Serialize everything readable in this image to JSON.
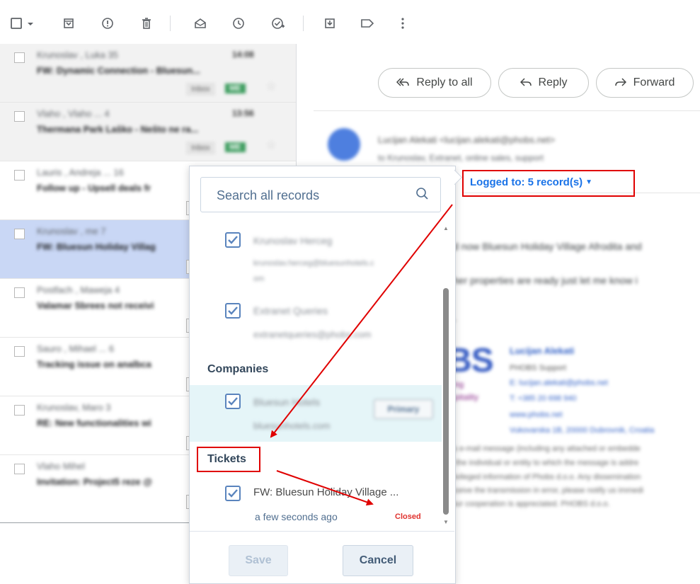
{
  "toolbar": {
    "icons": [
      "checkbox-icon",
      "chevron-down-icon",
      "archive-icon",
      "report-icon",
      "delete-icon",
      "mark-read-icon",
      "snooze-icon",
      "add-task-icon",
      "move-icon",
      "label-icon",
      "more-icon"
    ]
  },
  "email_list": {
    "rows": [
      {
        "sender": "Krunoslav , Luka 35",
        "subject": "FW: Dynamic Connection - Bluesun...",
        "time": "14:08",
        "label": "Inbox",
        "tag": "ME"
      },
      {
        "sender": "Vlaho , Vlaho ... 4",
        "subject": "Thermana Park Laško - Nešto ne ra...",
        "time": "13:56",
        "label": "Inbox",
        "tag": "ME"
      },
      {
        "sender": "Lauris , Andreja ... 16",
        "subject": "Follow up - Upsell deals fr"
      },
      {
        "sender": "Krunoslav , me 7",
        "subject": "FW: Bluesun Holiday Villag"
      },
      {
        "sender": "Postfach , Maweja 4",
        "subject": "Valamar Sbrees not receivi"
      },
      {
        "sender": "Sauro , Mihael ... 6",
        "subject": "Tracking issue on analbca"
      },
      {
        "sender": "Krunoslav, Maro 3",
        "subject": "RE: New functionalities wi"
      },
      {
        "sender": "Vlaho Mihel",
        "subject": "Invitation: Project5 reze @"
      }
    ]
  },
  "email": {
    "actions": {
      "reply_all": "Reply to all",
      "reply": "Reply",
      "forward": "Forward"
    },
    "from": "Lucijan Alekati <lucijan.alekati@phobs.net>",
    "to": "to Krunoslav, Extranet, online sales, support",
    "logged_to": "Logged to: 5 record(s)",
    "body": [
      "d now Bluesun Holiday Village Afrodita and",
      "her properties are ready just let me know i",
      ","
    ],
    "signature": {
      "logo": "BS",
      "sub1": "ting",
      "sub2": "spitality",
      "name": "Lucijan Alekati",
      "lines": [
        "PHOBS Support",
        "E: lucijan.alekati@phobs.net",
        "T: +385 20 698 940",
        "www.phobs.net",
        "Vukovarska 1B, 20000 Dubrovnik, Croatia"
      ]
    },
    "disclaimer": [
      "his e-mail message (including any attached or embedde",
      "of the individual or entity to which the message is addre",
      "privileged information of Phobs d.o.o. Any dissemination",
      "receive the transmission in error, please notify us immedi",
      "Your cooperation is appreciated. PHOBS d.o.o."
    ]
  },
  "popup": {
    "search_placeholder": "Search all records",
    "contacts": [
      {
        "name": "Krunoslav Herceg",
        "email": "krunoslav.herceg@bluesunhotels.c",
        "email2": "om"
      },
      {
        "name": "Extranet Queries",
        "email": "extranetqueries@phobs.com"
      }
    ],
    "companies_heading": "Companies",
    "company": {
      "name": "Bluesun Hotels",
      "domain": "bluesunhotels.com",
      "badge": "Primary"
    },
    "tickets_heading": "Tickets",
    "ticket": {
      "name": "FW: Bluesun Holiday Village ...",
      "time": "a few seconds ago",
      "status": "Closed"
    },
    "save_label": "Save",
    "cancel_label": "Cancel"
  },
  "colors": {
    "accent": "#1a73e8",
    "annotation_red": "#e00000",
    "status_closed": "#e0322e",
    "checkbox": "#5a84bd"
  }
}
